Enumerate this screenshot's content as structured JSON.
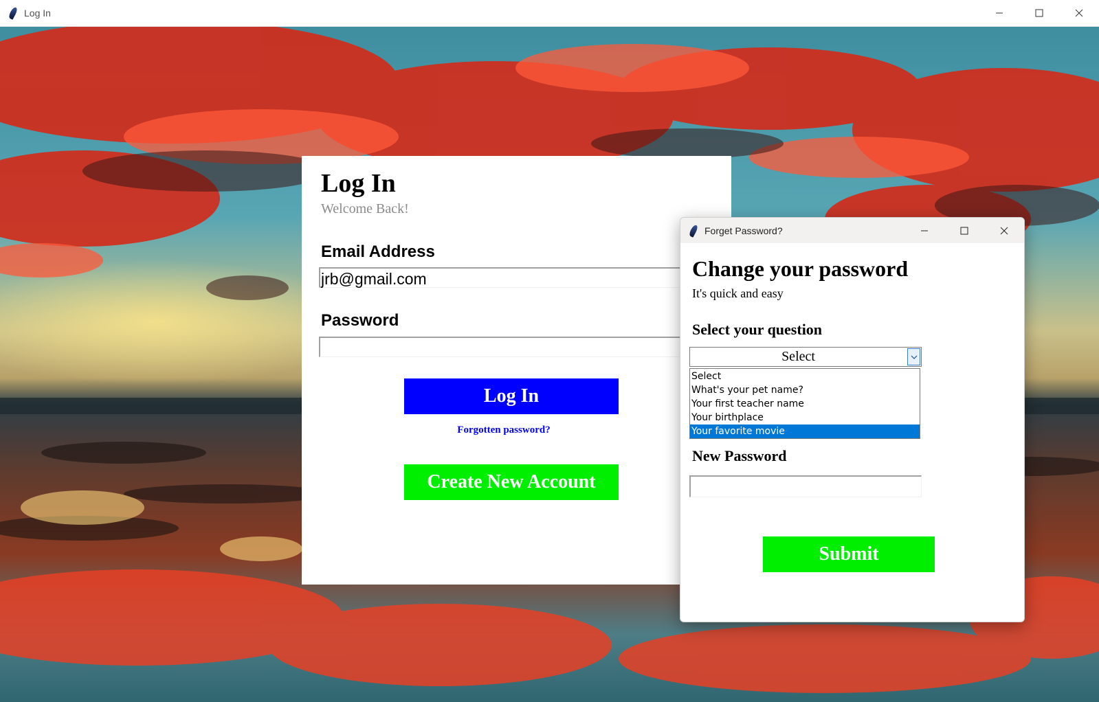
{
  "main_window": {
    "title": "Log In",
    "icon": "feather-icon"
  },
  "login": {
    "title": "Log In",
    "subtitle": "Welcome Back!",
    "email_label": "Email Address",
    "email_value": "jrb@gmail.com",
    "password_label": "Password",
    "password_value": "",
    "login_button": "Log In",
    "forgot_link": "Forgotten password?",
    "create_button": "Create New Account"
  },
  "dialog": {
    "title": "Forget Password?",
    "heading": "Change your password",
    "subheading": "It's quick and easy",
    "question_label": "Select your question",
    "question_value": "Select",
    "options": [
      "Select",
      "What's your pet name?",
      "Your first teacher name",
      "Your birthplace",
      "Your favorite movie"
    ],
    "selected_option": "Your favorite movie",
    "new_password_label": "New Password",
    "new_password_value": "",
    "submit_button": "Submit"
  },
  "colors": {
    "login_button": "#0000ff",
    "create_button": "#00ee00",
    "submit_button": "#00ee00",
    "link": "#0000ff",
    "list_selection": "#0078d7",
    "subtitle_gray": "#8a8a8a"
  }
}
